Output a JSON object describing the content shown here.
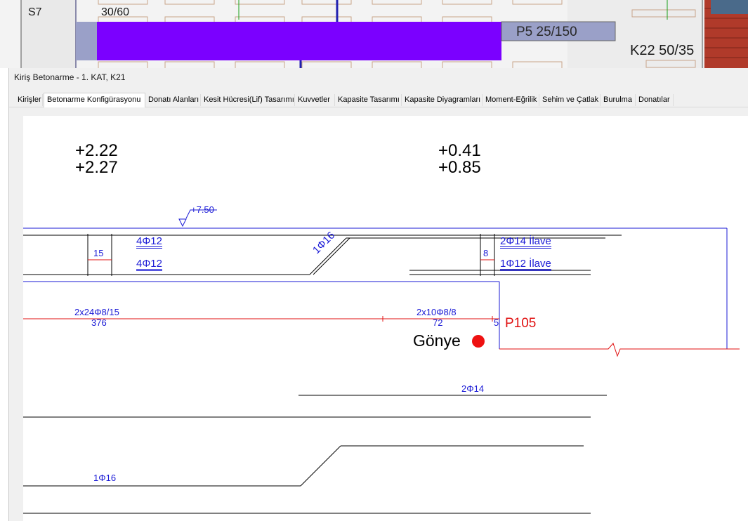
{
  "plan": {
    "labels": {
      "s7": "S7",
      "col_size": "30/60",
      "p5": "P5 25/150",
      "k22": "K22 50/35"
    }
  },
  "window": {
    "title": "Kiriş Betonarme - 1. KAT, K21",
    "tabs": [
      {
        "label": "Kirişler"
      },
      {
        "label": "Betonarme Konfigürasyonu"
      },
      {
        "label": "Donatı Alanları"
      },
      {
        "label": "Kesit Hücresi(Lif) Tasarımı"
      },
      {
        "label": "Kuvvetler"
      },
      {
        "label": "Kapasite Tasarımı"
      },
      {
        "label": "Kapasite Diyagramları"
      },
      {
        "label": "Moment-Eğrilik"
      },
      {
        "label": "Sehim ve Çatlak"
      },
      {
        "label": "Burulma"
      },
      {
        "label": "Donatılar"
      }
    ],
    "active_tab": 1
  },
  "drawing": {
    "left_top_value": "+2.22",
    "left_bottom_value": "+2.27",
    "right_top_value": "+0.41",
    "right_bottom_value": "+0.85",
    "elevation": "+7.50",
    "dim_15": "15",
    "dim_8": "8",
    "top_bars_1": "4Φ12",
    "top_bars_2": "4Φ12",
    "bent_bar": "1Φ16",
    "extra_1": "2Φ14 İlave",
    "extra_2": "1Φ12 İlave",
    "stirrup_left": "2x24Φ8/15",
    "stirrup_left_len": "376",
    "stirrup_right": "2x10Φ8/8",
    "stirrup_right_len": "72",
    "end_dim": "5",
    "support": "P105",
    "gonye": "Gönye",
    "bar_detail_1": "2Φ14",
    "bar_detail_2": "1Φ16"
  },
  "colors": {
    "blue": "#1a1ad6",
    "red": "#e01010",
    "purple": "#7b00ff"
  }
}
